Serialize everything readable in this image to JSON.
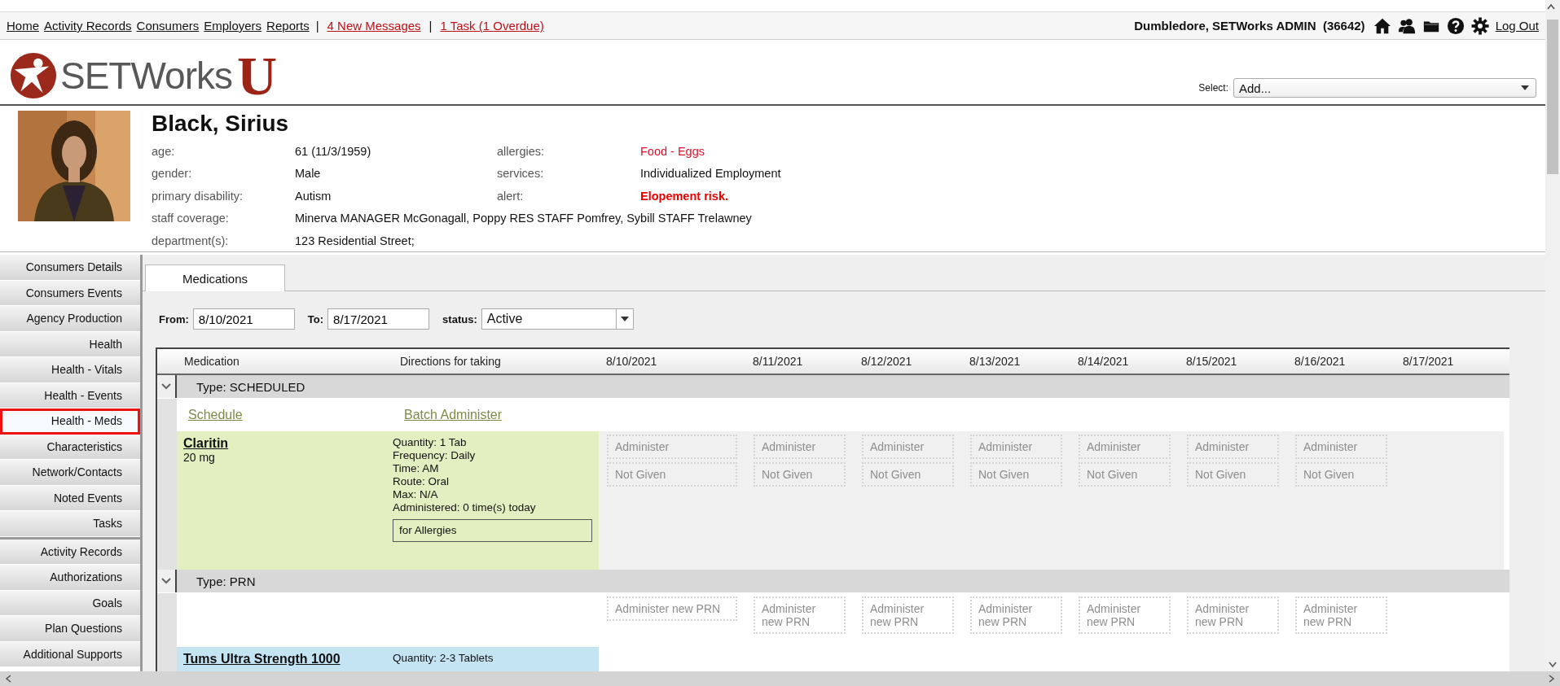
{
  "nav": {
    "items": [
      {
        "kind": "link",
        "label": "Home"
      },
      {
        "kind": "link",
        "label": "Activity Records"
      },
      {
        "kind": "link",
        "label": "Consumers"
      },
      {
        "kind": "link",
        "label": "Employers"
      },
      {
        "kind": "link",
        "label": "Reports"
      },
      {
        "kind": "separator",
        "label": "|"
      },
      {
        "kind": "alert",
        "label": "4 New Messages"
      },
      {
        "kind": "separator",
        "label": "|"
      },
      {
        "kind": "alert",
        "label": "1 Task (1 Overdue)"
      }
    ],
    "user": "Dumbledore, SETWorks ADMIN  (36642)",
    "icons": [
      {
        "kind": "home"
      },
      {
        "kind": "users"
      },
      {
        "kind": "folder"
      },
      {
        "kind": "help"
      },
      {
        "kind": "settings"
      }
    ],
    "logout": "Log Out"
  },
  "logo": {
    "text": "SETWorks",
    "mark": "U"
  },
  "select": {
    "label": "Select:",
    "value": "Add..."
  },
  "consumer": {
    "name": "Black, Sirius",
    "rows": [
      {
        "fields": [
          {
            "label": "age:",
            "value": "61 (11/3/1959)",
            "kind": "normal"
          },
          {
            "label": "allergies:",
            "value": "Food - Eggs",
            "kind": "warning"
          }
        ]
      },
      {
        "fields": [
          {
            "label": "gender:",
            "value": "Male",
            "kind": "normal"
          },
          {
            "label": "services:",
            "value": "Individualized Employment",
            "kind": "normal"
          }
        ]
      },
      {
        "fields": [
          {
            "label": "primary disability:",
            "value": "Autism",
            "kind": "normal"
          },
          {
            "label": "alert:",
            "value": "Elopement risk.",
            "kind": "alert"
          }
        ]
      },
      {
        "fields": [
          {
            "label": "staff coverage:",
            "value": "Minerva MANAGER McGonagall, Poppy RES STAFF Pomfrey, Sybill STAFF Trelawney",
            "kind": "normal"
          }
        ]
      },
      {
        "fields": [
          {
            "label": "department(s):",
            "value": "123 Residential Street;",
            "kind": "normal"
          }
        ]
      }
    ]
  },
  "sidebar": {
    "groups": [
      {
        "items": [
          {
            "label": "Consumers Details",
            "selected": false
          },
          {
            "label": "Consumers Events",
            "selected": false
          },
          {
            "label": "Agency Production",
            "selected": false
          },
          {
            "label": "Health",
            "selected": false
          },
          {
            "label": "Health - Vitals",
            "selected": false
          },
          {
            "label": "Health - Events",
            "selected": false
          },
          {
            "label": "Health - Meds",
            "selected": true
          },
          {
            "label": "Characteristics",
            "selected": false
          },
          {
            "label": "Network/Contacts",
            "selected": false
          },
          {
            "label": "Noted Events",
            "selected": false
          },
          {
            "label": "Tasks",
            "selected": false
          }
        ]
      },
      {
        "items": [
          {
            "label": "Activity Records",
            "selected": false
          },
          {
            "label": "Authorizations",
            "selected": false
          },
          {
            "label": "Goals",
            "selected": false
          },
          {
            "label": "Plan Questions",
            "selected": false
          },
          {
            "label": "Additional Supports",
            "selected": false
          }
        ]
      }
    ]
  },
  "tabs": [
    {
      "label": "Medications",
      "selected": true
    }
  ],
  "filters": {
    "from": {
      "label": "From:",
      "value": "8/10/2021"
    },
    "to": {
      "label": "To:",
      "value": "8/17/2021"
    },
    "status": {
      "label": "status:",
      "value": "Active"
    }
  },
  "table": {
    "columns": [
      "Medication",
      "Directions for taking",
      "8/10/2021",
      "8/11/2021",
      "8/12/2021",
      "8/13/2021",
      "8/14/2021",
      "8/15/2021",
      "8/16/2021",
      "8/17/2021"
    ],
    "groups": [
      {
        "title": "Type: SCHEDULED",
        "expanded": true,
        "links": [
          "Schedule",
          "Batch Administer"
        ],
        "meds": [
          {
            "name": "Claritin",
            "dose": "20 mg",
            "color": "#e2efc0",
            "directions": [
              "Quantity: 1 Tab",
              "Frequency: Daily",
              "Time: AM",
              "Route: Oral",
              "Max: N/A",
              "Administered: 0 time(s) today"
            ],
            "note": "for Allergies",
            "days": [
              {
                "actions": [
                  "Administer",
                  "Not Given"
                ]
              },
              {
                "actions": [
                  "Administer",
                  "Not Given"
                ]
              },
              {
                "actions": [
                  "Administer",
                  "Not Given"
                ]
              },
              {
                "actions": [
                  "Administer",
                  "Not Given"
                ]
              },
              {
                "actions": [
                  "Administer",
                  "Not Given"
                ]
              },
              {
                "actions": [
                  "Administer",
                  "Not Given"
                ]
              },
              {
                "actions": [
                  "Administer",
                  "Not Given"
                ]
              }
            ]
          }
        ]
      },
      {
        "title": "Type: PRN",
        "expanded": true,
        "new_actions": [
          "Administer new PRN",
          "Administer new PRN",
          "Administer new PRN",
          "Administer new PRN",
          "Administer new PRN",
          "Administer new PRN",
          "Administer new PRN"
        ],
        "meds": [
          {
            "name": "Tums Ultra Strength 1000",
            "color": "#c5e4f3",
            "directions": [
              "Quantity: 2-3 Tablets"
            ]
          }
        ]
      }
    ]
  }
}
